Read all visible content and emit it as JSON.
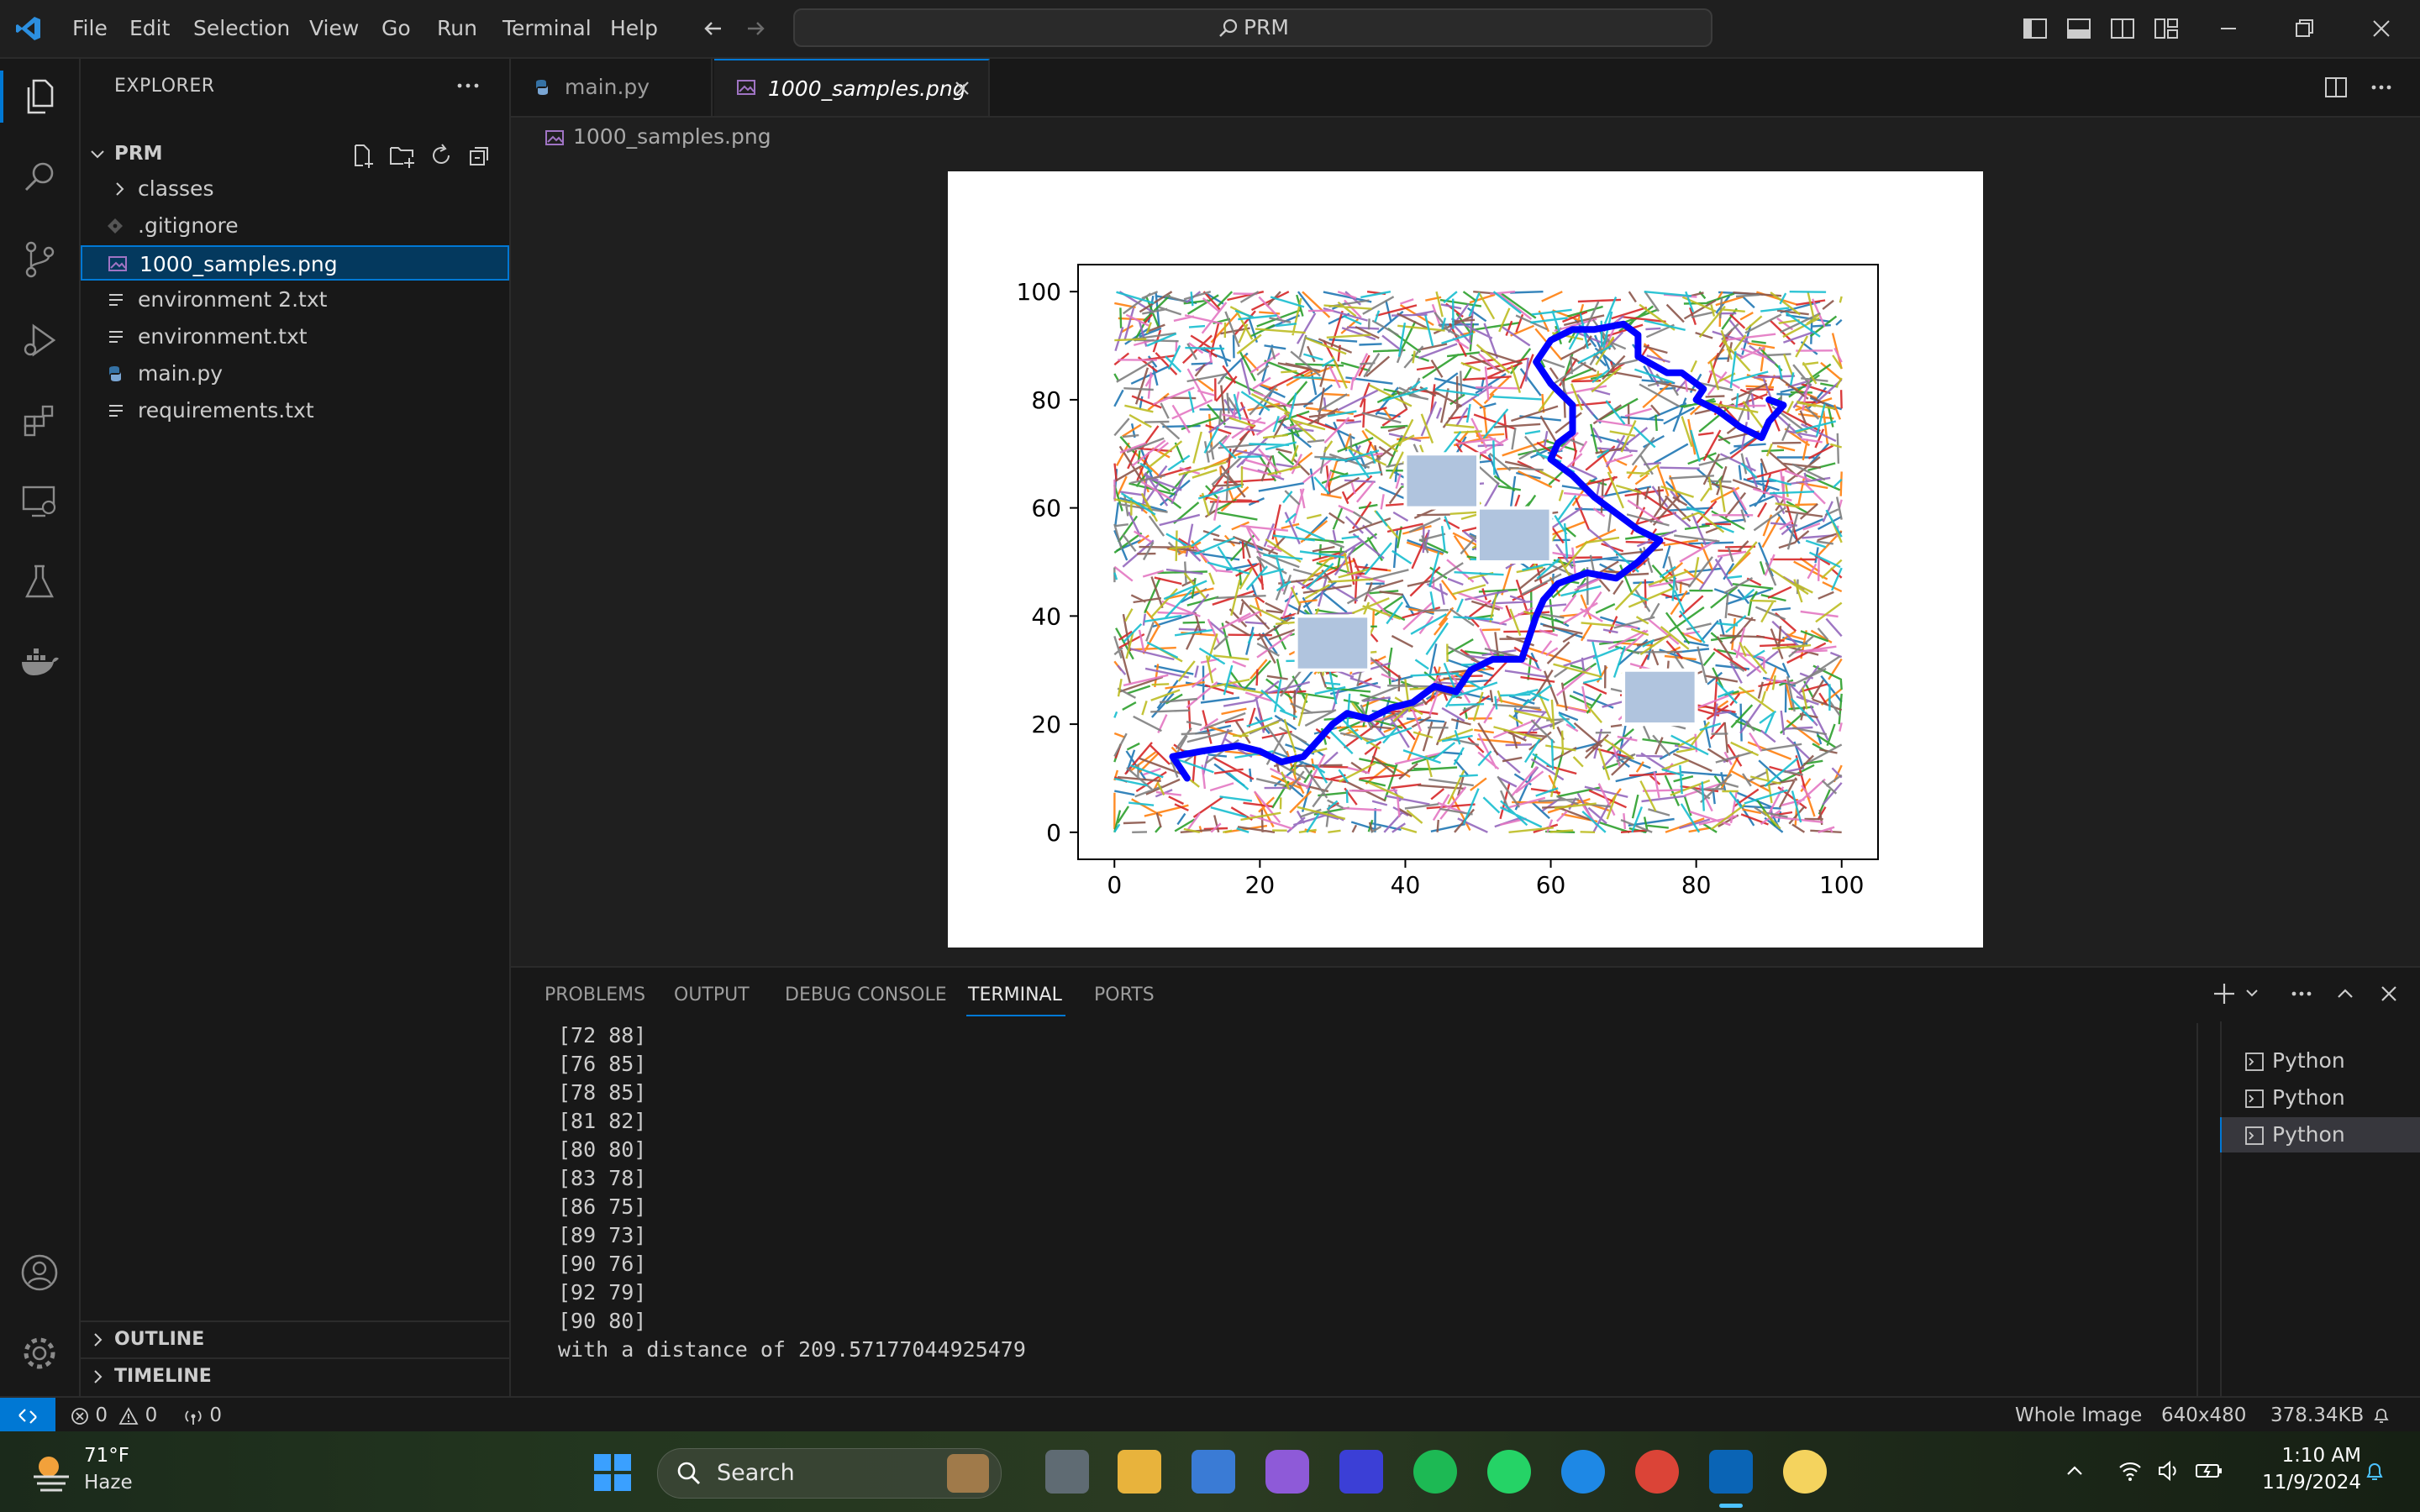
{
  "titlebar": {
    "menu": [
      "File",
      "Edit",
      "Selection",
      "View",
      "Go",
      "Run",
      "Terminal",
      "Help"
    ],
    "search": "PRM"
  },
  "sidebar": {
    "title": "EXPLORER",
    "folder": "PRM",
    "items": [
      {
        "label": "classes",
        "type": "folder"
      },
      {
        "label": ".gitignore",
        "type": "git"
      },
      {
        "label": "1000_samples.png",
        "type": "image",
        "selected": true
      },
      {
        "label": "environment 2.txt",
        "type": "text"
      },
      {
        "label": "environment.txt",
        "type": "text"
      },
      {
        "label": "main.py",
        "type": "python"
      },
      {
        "label": "requirements.txt",
        "type": "text"
      }
    ],
    "outline": "OUTLINE",
    "timeline": "TIMELINE"
  },
  "tabs": [
    {
      "label": "main.py",
      "active": false
    },
    {
      "label": "1000_samples.png",
      "active": true
    }
  ],
  "breadcrumb": "1000_samples.png",
  "chart_data": {
    "type": "line",
    "title": "",
    "xlabel": "",
    "ylabel": "",
    "xlim": [
      -5,
      105
    ],
    "ylim": [
      -5,
      105
    ],
    "xticks": [
      0,
      20,
      40,
      60,
      80,
      100
    ],
    "yticks": [
      0,
      20,
      40,
      60,
      80,
      100
    ],
    "obstacles": [
      {
        "x": 40,
        "y": 60,
        "w": 10,
        "h": 10
      },
      {
        "x": 50,
        "y": 50,
        "w": 10,
        "h": 10
      },
      {
        "x": 25,
        "y": 30,
        "w": 10,
        "h": 10
      },
      {
        "x": 70,
        "y": 20,
        "w": 10,
        "h": 10
      }
    ],
    "path": [
      [
        10,
        10
      ],
      [
        8,
        14
      ],
      [
        12,
        15
      ],
      [
        17,
        16
      ],
      [
        20,
        15
      ],
      [
        23,
        13
      ],
      [
        26,
        14
      ],
      [
        28,
        17
      ],
      [
        30,
        20
      ],
      [
        32,
        22
      ],
      [
        35,
        21
      ],
      [
        38,
        23
      ],
      [
        41,
        24
      ],
      [
        44,
        27
      ],
      [
        47,
        26
      ],
      [
        49,
        30
      ],
      [
        52,
        32
      ],
      [
        56,
        32
      ],
      [
        57,
        36
      ],
      [
        58,
        40
      ],
      [
        59,
        43
      ],
      [
        61,
        46
      ],
      [
        65,
        48
      ],
      [
        69,
        47
      ],
      [
        72,
        50
      ],
      [
        75,
        54
      ],
      [
        72,
        56
      ],
      [
        69,
        59
      ],
      [
        66,
        62
      ],
      [
        63,
        66
      ],
      [
        60,
        69
      ],
      [
        61,
        72
      ],
      [
        63,
        74
      ],
      [
        63,
        79
      ],
      [
        60,
        83
      ],
      [
        58,
        87
      ],
      [
        60,
        91
      ],
      [
        63,
        93
      ],
      [
        66,
        93
      ],
      [
        70,
        94
      ],
      [
        72,
        92
      ],
      [
        72,
        88
      ],
      [
        76,
        85
      ],
      [
        78,
        85
      ],
      [
        81,
        82
      ],
      [
        80,
        80
      ],
      [
        83,
        78
      ],
      [
        86,
        75
      ],
      [
        89,
        73
      ],
      [
        90,
        76
      ],
      [
        92,
        79
      ],
      [
        90,
        80
      ]
    ],
    "path_color": "#0000ff",
    "obstacle_color": "#b0c4de"
  },
  "panel": {
    "tabs": [
      "PROBLEMS",
      "OUTPUT",
      "DEBUG CONSOLE",
      "TERMINAL",
      "PORTS"
    ],
    "terminal_lines": [
      "[72 88]",
      "[76 85]",
      "[78 85]",
      "[81 82]",
      "[80 80]",
      "[83 78]",
      "[86 75]",
      "[89 73]",
      "[90 76]",
      "[92 79]",
      "[90 80]",
      "with a distance of 209.57177044925479"
    ],
    "terminals": [
      "Python",
      "Python",
      "Python"
    ]
  },
  "statusbar": {
    "errors": "0",
    "warnings": "0",
    "ports": "0",
    "zoom": "Whole Image",
    "dimensions": "640x480",
    "size": "378.34KB"
  },
  "taskbar": {
    "weather_temp": "71°F",
    "weather_desc": "Haze",
    "search": "Search",
    "time": "1:10 AM",
    "date": "11/9/2024"
  }
}
